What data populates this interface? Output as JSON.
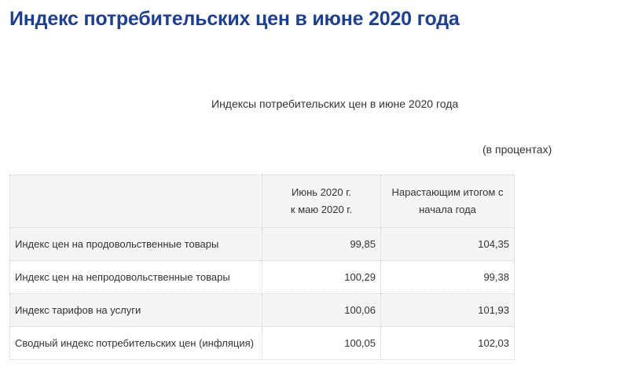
{
  "page": {
    "title": "Индекс потребительских цен в июне 2020 года"
  },
  "table": {
    "caption": "Индексы потребительских цен в июне 2020 года",
    "units": "(в процентах)",
    "headers": {
      "name": "",
      "month_line1": "Июнь 2020 г.",
      "month_line2": "к маю 2020 г.",
      "cumulative_line1": "Нарастающим итогом с",
      "cumulative_line2": "начала года"
    },
    "rows": [
      {
        "name": "Индекс цен на продовольственные товары",
        "month": "99,85",
        "cumulative": "104,35"
      },
      {
        "name": "Индекс цен на непродовольственные товары",
        "month": "100,29",
        "cumulative": "99,38"
      },
      {
        "name": "Индекс тарифов на услуги",
        "month": "100,06",
        "cumulative": "101,93"
      },
      {
        "name": "Сводный индекс потребительских цен (инфляция)",
        "month": "100,05",
        "cumulative": "102,03"
      }
    ]
  },
  "colors": {
    "title": "#1f3f8f",
    "text": "#333333",
    "row_alt_background": "#f5f5f5",
    "border": "#cfcfcf"
  }
}
